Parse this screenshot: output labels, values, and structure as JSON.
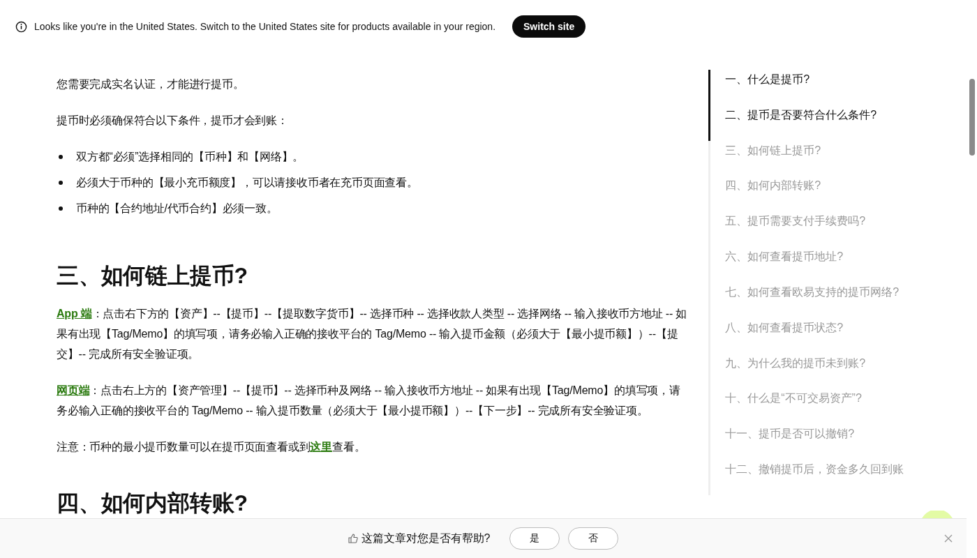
{
  "banner": {
    "message": "Looks like you're in the United States. Switch to the United States site for products available in your region.",
    "button": "Switch site"
  },
  "article": {
    "blocks": [
      {
        "kind": "paragraph",
        "text": "您需要完成实名认证，才能进行提币。"
      },
      {
        "kind": "paragraph",
        "text": "提币时必须确保符合以下条件，提币才会到账："
      },
      {
        "kind": "bullets",
        "items": [
          "双方都“必须”选择相同的【币种】和【网络】。",
          "必须大于币种的【最小充币额度】，可以请接收币者在充币页面查看。",
          "币种的【合约地址/代币合约】必须一致。"
        ]
      },
      {
        "kind": "heading",
        "text": "三、如何链上提币?"
      },
      {
        "kind": "linked",
        "link": "App 端",
        "text": "：点击右下方的【资产】--【提币】--【提取数字货币】-- 选择币种 -- 选择收款人类型 -- 选择网络 -- 输入接收币方地址 -- 如果有出现【Tag/Memo】的填写项，请务必输入正确的接收平台的 Tag/Memo -- 输入提币金额（必须大于【最小提币额】）--【提交】-- 完成所有安全验证项。"
      },
      {
        "kind": "linked",
        "link": "网页端",
        "text": "：点击右上方的【资产管理】--【提币】-- 选择币种及网络 -- 输入接收币方地址 -- 如果有出现【Tag/Memo】的填写项，请务必输入正确的接收平台的 Tag/Memo -- 输入提币数量（必须大于【最小提币额】）--【下一步】-- 完成所有安全验证项。"
      },
      {
        "kind": "note",
        "text": "注意：币种的最小提币数量可以在提币页面查看或到",
        "link": "这里",
        "after": "查看。"
      },
      {
        "kind": "heading",
        "text": "四、如何内部转账?"
      }
    ]
  },
  "toc": [
    {
      "label": "一、什么是提币?",
      "selected": true
    },
    {
      "label": "二、提币是否要符合什么条件?",
      "selected": true
    },
    {
      "label": "三、如何链上提币?",
      "selected": false
    },
    {
      "label": "四、如何内部转账?",
      "selected": false
    },
    {
      "label": "五、提币需要支付手续费吗?",
      "selected": false
    },
    {
      "label": "六、如何查看提币地址?",
      "selected": false
    },
    {
      "label": "七、如何查看欧易支持的提币网络?",
      "selected": false
    },
    {
      "label": "八、如何查看提币状态?",
      "selected": false
    },
    {
      "label": "九、为什么我的提币未到账?",
      "selected": false
    },
    {
      "label": "十、什么是“不可交易资产”?",
      "selected": false
    },
    {
      "label": "十一、提币是否可以撤销?",
      "selected": false
    },
    {
      "label": "十二、撤销提币后，资金多久回到账",
      "selected": false
    }
  ],
  "feedback": {
    "question": "这篇文章对您是否有帮助?",
    "yes": "是",
    "no": "否"
  }
}
